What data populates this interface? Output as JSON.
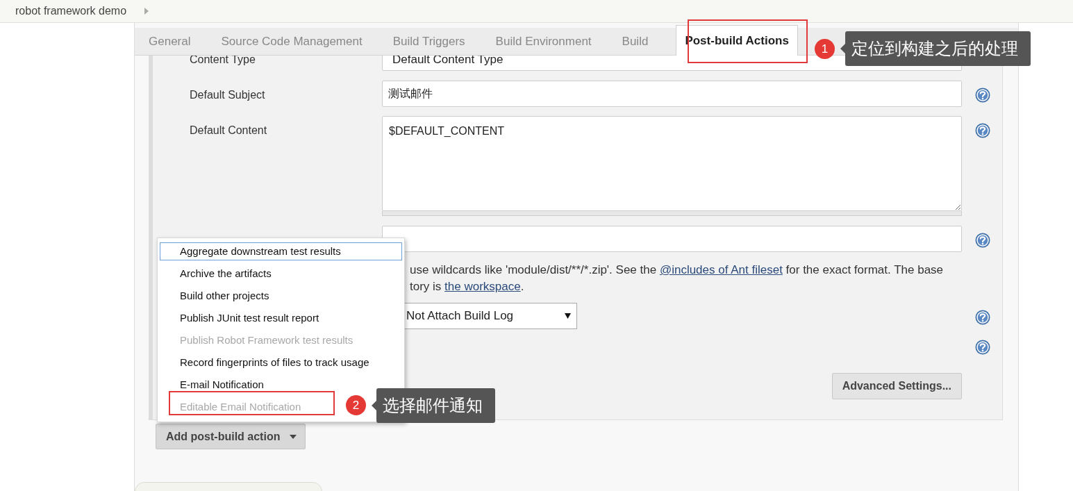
{
  "breadcrumb": {
    "items": [
      {
        "label": "robot framework demo"
      }
    ]
  },
  "tabs": [
    {
      "label": "General",
      "selected": false
    },
    {
      "label": "Source Code Management",
      "selected": false
    },
    {
      "label": "Build Triggers",
      "selected": false
    },
    {
      "label": "Build Environment",
      "selected": false
    },
    {
      "label": "Build",
      "selected": false
    },
    {
      "label": "Post-build Actions",
      "selected": true
    }
  ],
  "form": {
    "rows": [
      {
        "kind": "select",
        "label": "Content Type",
        "value": "Default Content Type"
      },
      {
        "kind": "text",
        "label": "Default Subject",
        "value": "测试邮件",
        "help": true
      },
      {
        "kind": "textarea",
        "label": "Default Content",
        "value": "$DEFAULT_CONTENT",
        "help": true
      },
      {
        "kind": "text",
        "value": "",
        "help": true
      },
      {
        "kind": "note",
        "lines": [
          [
            {
              "text": "use wildcards like 'module/dist/**/*.zip'. See the "
            },
            {
              "link": "@includes of Ant fileset"
            },
            {
              "text": " for the exact format. The base"
            }
          ],
          [
            {
              "text": "tory is "
            },
            {
              "link": "the workspace"
            },
            {
              "text": "."
            }
          ]
        ]
      },
      {
        "kind": "select",
        "value": "Not Attach Build Log",
        "help": true
      },
      {
        "kind": "help_only",
        "help": true
      },
      {
        "kind": "button",
        "label": "Advanced Settings..."
      }
    ]
  },
  "add_button": {
    "label": "Add post-build action"
  },
  "menu": {
    "items": [
      {
        "label": "Aggregate downstream test results",
        "selected": true,
        "disabled": false
      },
      {
        "label": "Archive the artifacts",
        "selected": false,
        "disabled": false
      },
      {
        "label": "Build other projects",
        "selected": false,
        "disabled": false
      },
      {
        "label": "Publish JUnit test result report",
        "selected": false,
        "disabled": false
      },
      {
        "label": "Publish Robot Framework test results",
        "selected": false,
        "disabled": true
      },
      {
        "label": "Record fingerprints of files to track usage",
        "selected": false,
        "disabled": false
      },
      {
        "label": "E-mail Notification",
        "selected": false,
        "disabled": false
      },
      {
        "label": "Editable Email Notification",
        "selected": false,
        "disabled": true
      }
    ]
  },
  "annotations": [
    {
      "number": "1",
      "text": "定位到构建之后的处理"
    },
    {
      "number": "2",
      "text": "选择邮件通知"
    }
  ]
}
